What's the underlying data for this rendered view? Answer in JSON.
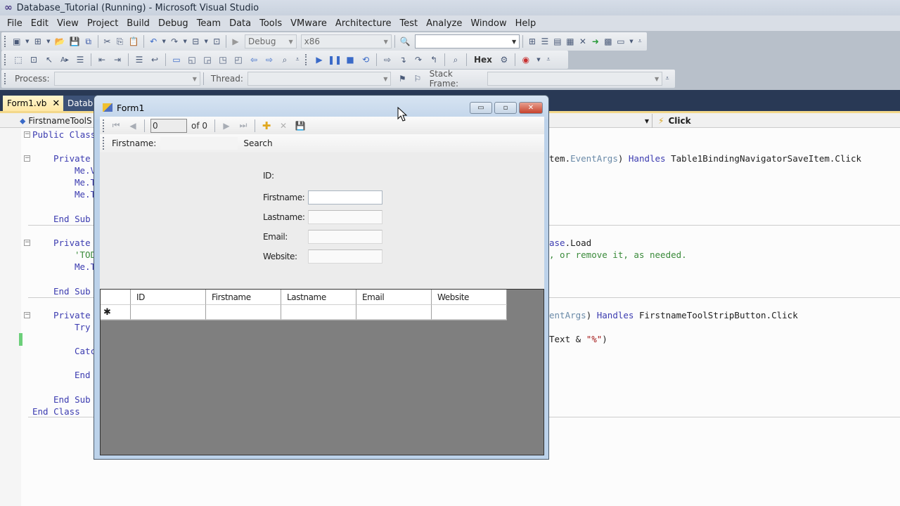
{
  "app": {
    "title": "Database_Tutorial (Running) - Microsoft Visual Studio",
    "logo": "∞"
  },
  "menu": [
    "File",
    "Edit",
    "View",
    "Project",
    "Build",
    "Debug",
    "Team",
    "Data",
    "Tools",
    "VMware",
    "Architecture",
    "Test",
    "Analyze",
    "Window",
    "Help"
  ],
  "toolbar": {
    "config": "Debug",
    "platform": "x86",
    "find_value": "",
    "hex_label": "Hex",
    "process_label": "Process:",
    "thread_label": "Thread:",
    "stack_frame_label": "Stack Frame:",
    "process_value": "",
    "thread_value": "",
    "stack_frame_value": ""
  },
  "tabs": [
    {
      "label": "Form1.vb",
      "active": true,
      "close": "✕"
    },
    {
      "label": "Database",
      "active": false
    }
  ],
  "editor_nav": {
    "left": "FirstnameToolS",
    "right": "Click"
  },
  "code": {
    "left": [
      "Public Class",
      "Private",
      "Me.V",
      "Me.T",
      "Me.T",
      "End Sub",
      "Private",
      "'TOD",
      "Me.T",
      "End Sub",
      "Private",
      "Try",
      "Catc",
      "End",
      "End Sub",
      "End Class"
    ],
    "right": {
      "line1_a": "tem.",
      "line1_b": "EventArgs",
      "line1_c": ") ",
      "line1_kw": "Handles",
      "line1_d": " Table1BindingNavigatorSaveItem.Click",
      "line2_a": "ase",
      "line2_b": ".Load",
      "line3": ", or remove it, as needed.",
      "line4_a": "entArgs",
      "line4_b": ") ",
      "line4_kw": "Handles",
      "line4_c": " FirstnameToolStripButton.Click",
      "line5_a": "Text & ",
      "line5_str": "\"%\"",
      "line5_b": ")"
    }
  },
  "form": {
    "title": "Form1",
    "navigator": {
      "position": "0",
      "count": "of 0"
    },
    "search": {
      "label": "Firstname:",
      "value": "",
      "button": "Search"
    },
    "fields": [
      {
        "label": "ID:",
        "value": null
      },
      {
        "label": "Firstname:",
        "value": ""
      },
      {
        "label": "Lastname:",
        "value": ""
      },
      {
        "label": "Email:",
        "value": ""
      },
      {
        "label": "Website:",
        "value": ""
      }
    ],
    "grid": {
      "columns": [
        "ID",
        "Firstname",
        "Lastname",
        "Email",
        "Website"
      ],
      "new_row_marker": "✱",
      "rows": []
    },
    "window_buttons": {
      "minimize": "▭",
      "maximize": "▫",
      "close": "✕"
    }
  }
}
